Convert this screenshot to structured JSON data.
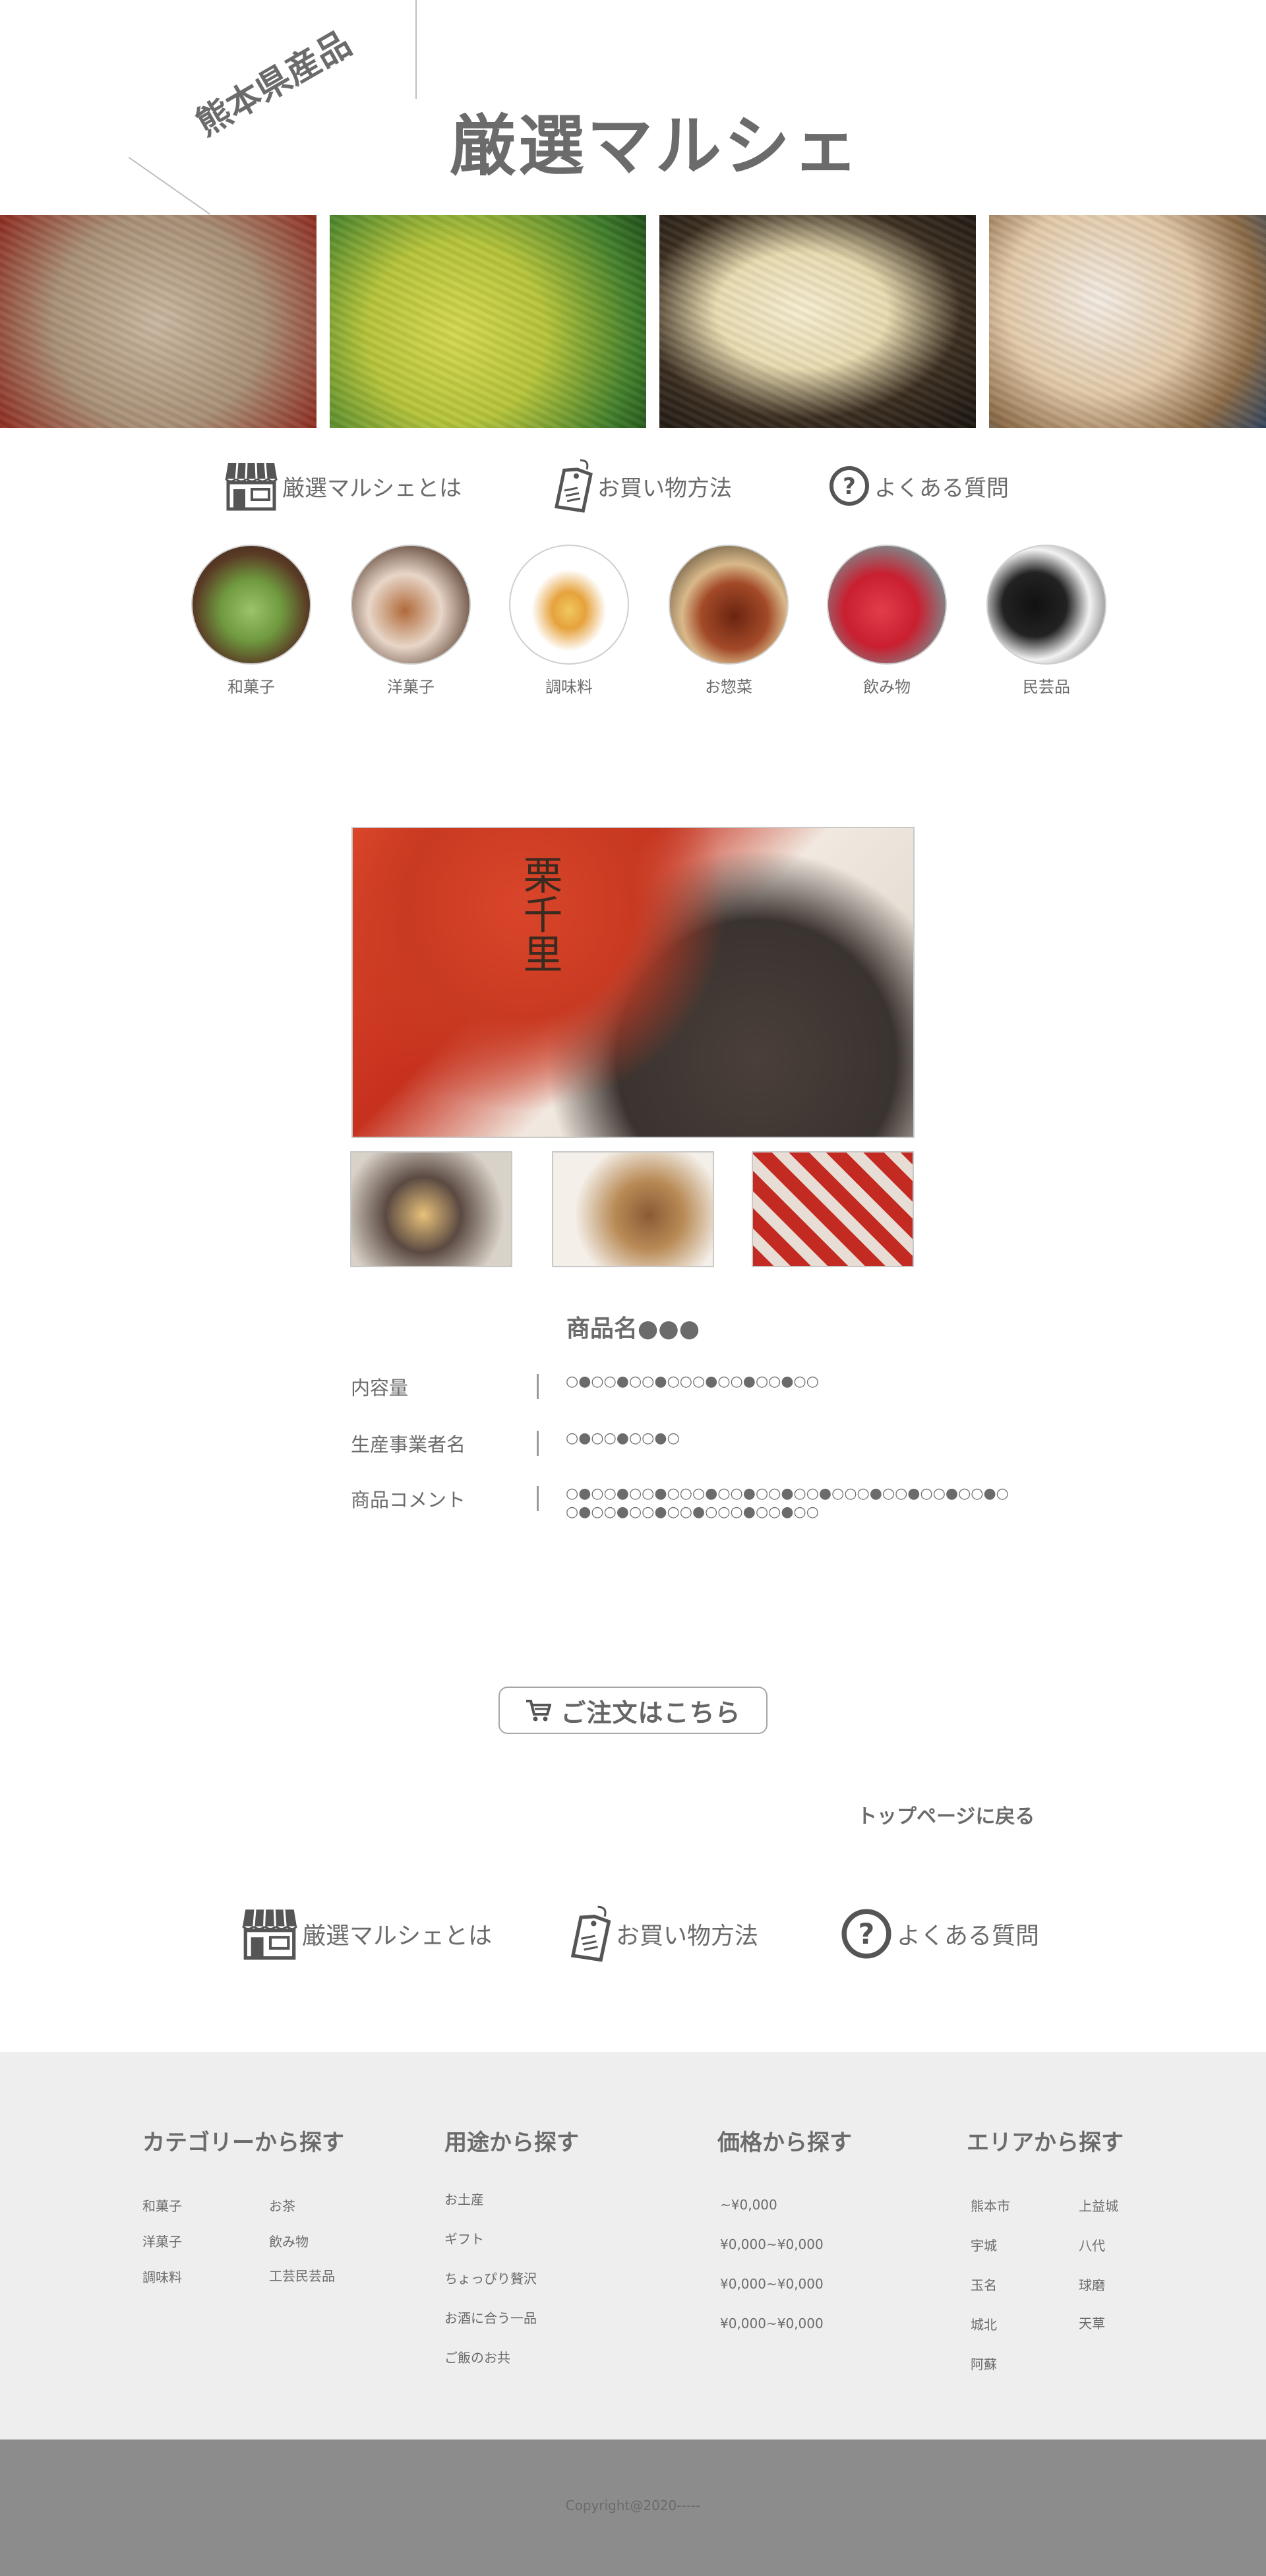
{
  "header": {
    "tagline": "熊本県産品",
    "site_title": "厳選マルシェ"
  },
  "hero": {
    "photos": [
      "zaru-soba",
      "matcha-ice-cream",
      "tofu-pudding",
      "cream-bun"
    ]
  },
  "nav": {
    "items": [
      {
        "label": "厳選マルシェとは",
        "icon": "shop-icon"
      },
      {
        "label": "お買い物方法",
        "icon": "price-tag-icon"
      },
      {
        "label": "よくある質問",
        "icon": "question-circle-icon"
      }
    ]
  },
  "categories": [
    {
      "label": "和菓子"
    },
    {
      "label": "洋菓子"
    },
    {
      "label": "調味料"
    },
    {
      "label": "お惣菜"
    },
    {
      "label": "飲み物"
    },
    {
      "label": "民芸品"
    }
  ],
  "product": {
    "box_text": "栗千里",
    "name": "商品名●●●",
    "specs": [
      {
        "key": "内容量",
        "value": "○●○○●○○●○○○●○○●○○●○○"
      },
      {
        "key": "生産事業者名",
        "value": "○●○○●○○●○"
      },
      {
        "key": "商品コメント",
        "value": "○●○○●○○●○○○●○○●○○●○○●○○○●○○●○○●○○●○\n○●○○●○○●○○●○○○●○○●○○"
      }
    ]
  },
  "order": {
    "button_label": "ご注文はこちら",
    "back_link": "トップページに戻る"
  },
  "footer": {
    "columns": [
      {
        "title": "カテゴリーから探す",
        "links": [
          "和菓子",
          "洋菓子",
          "調味料",
          "お茶",
          "飲み物",
          "工芸民芸品"
        ]
      },
      {
        "title": "用途から探す",
        "links": [
          "お土産",
          "ギフト",
          "ちょっぴり贅沢",
          "お酒に合う一品",
          "ご飯のお共"
        ]
      },
      {
        "title": "価格から探す",
        "links": [
          "~¥0,000",
          "¥0,000~¥0,000",
          "¥0,000~¥0,000",
          "¥0,000~¥0,000"
        ]
      },
      {
        "title": "エリアから探す",
        "links": [
          "熊本市",
          "宇城",
          "玉名",
          "城北",
          "阿蘇",
          "上益城",
          "八代",
          "球磨",
          "天草"
        ]
      }
    ],
    "copyright": "Copyright@2020-----"
  },
  "colors": {
    "text": "#666666",
    "footer_bg": "#eeeeee",
    "copyright_bg": "#8c8c8c"
  }
}
